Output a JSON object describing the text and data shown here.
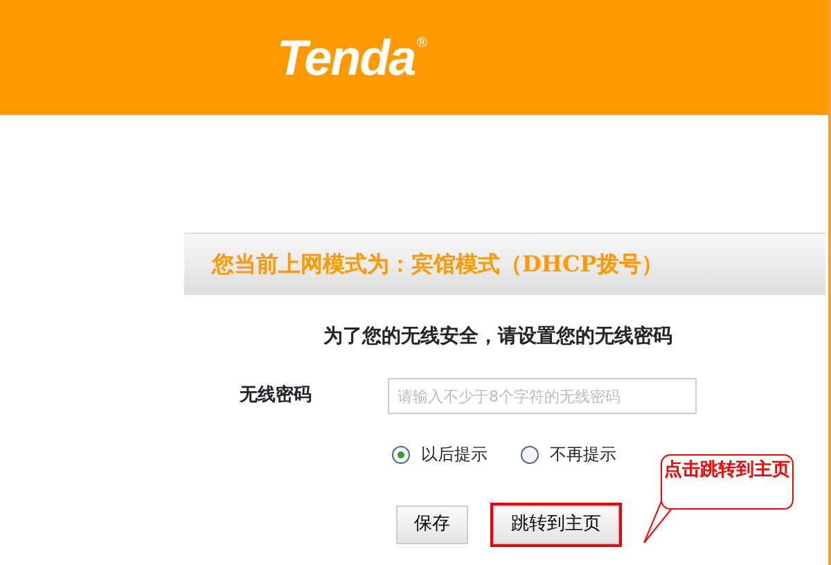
{
  "header": {
    "logo": "Tenda",
    "logo_mark": "®"
  },
  "panel": {
    "title": "您当前上网模式为：宾馆模式（DHCP拨号）",
    "prompt": "为了您的无线安全，请设置您的无线密码",
    "password": {
      "label": "无线密码",
      "placeholder": "请输入不少于8个字符的无线密码"
    },
    "reminder_options": [
      {
        "label": "以后提示",
        "selected": true
      },
      {
        "label": "不再提示",
        "selected": false
      }
    ],
    "buttons": [
      {
        "label": "保存",
        "highlighted": false
      },
      {
        "label": "跳转到主页",
        "highlighted": true
      }
    ]
  },
  "callout": {
    "text": "点击跳转到主页"
  }
}
